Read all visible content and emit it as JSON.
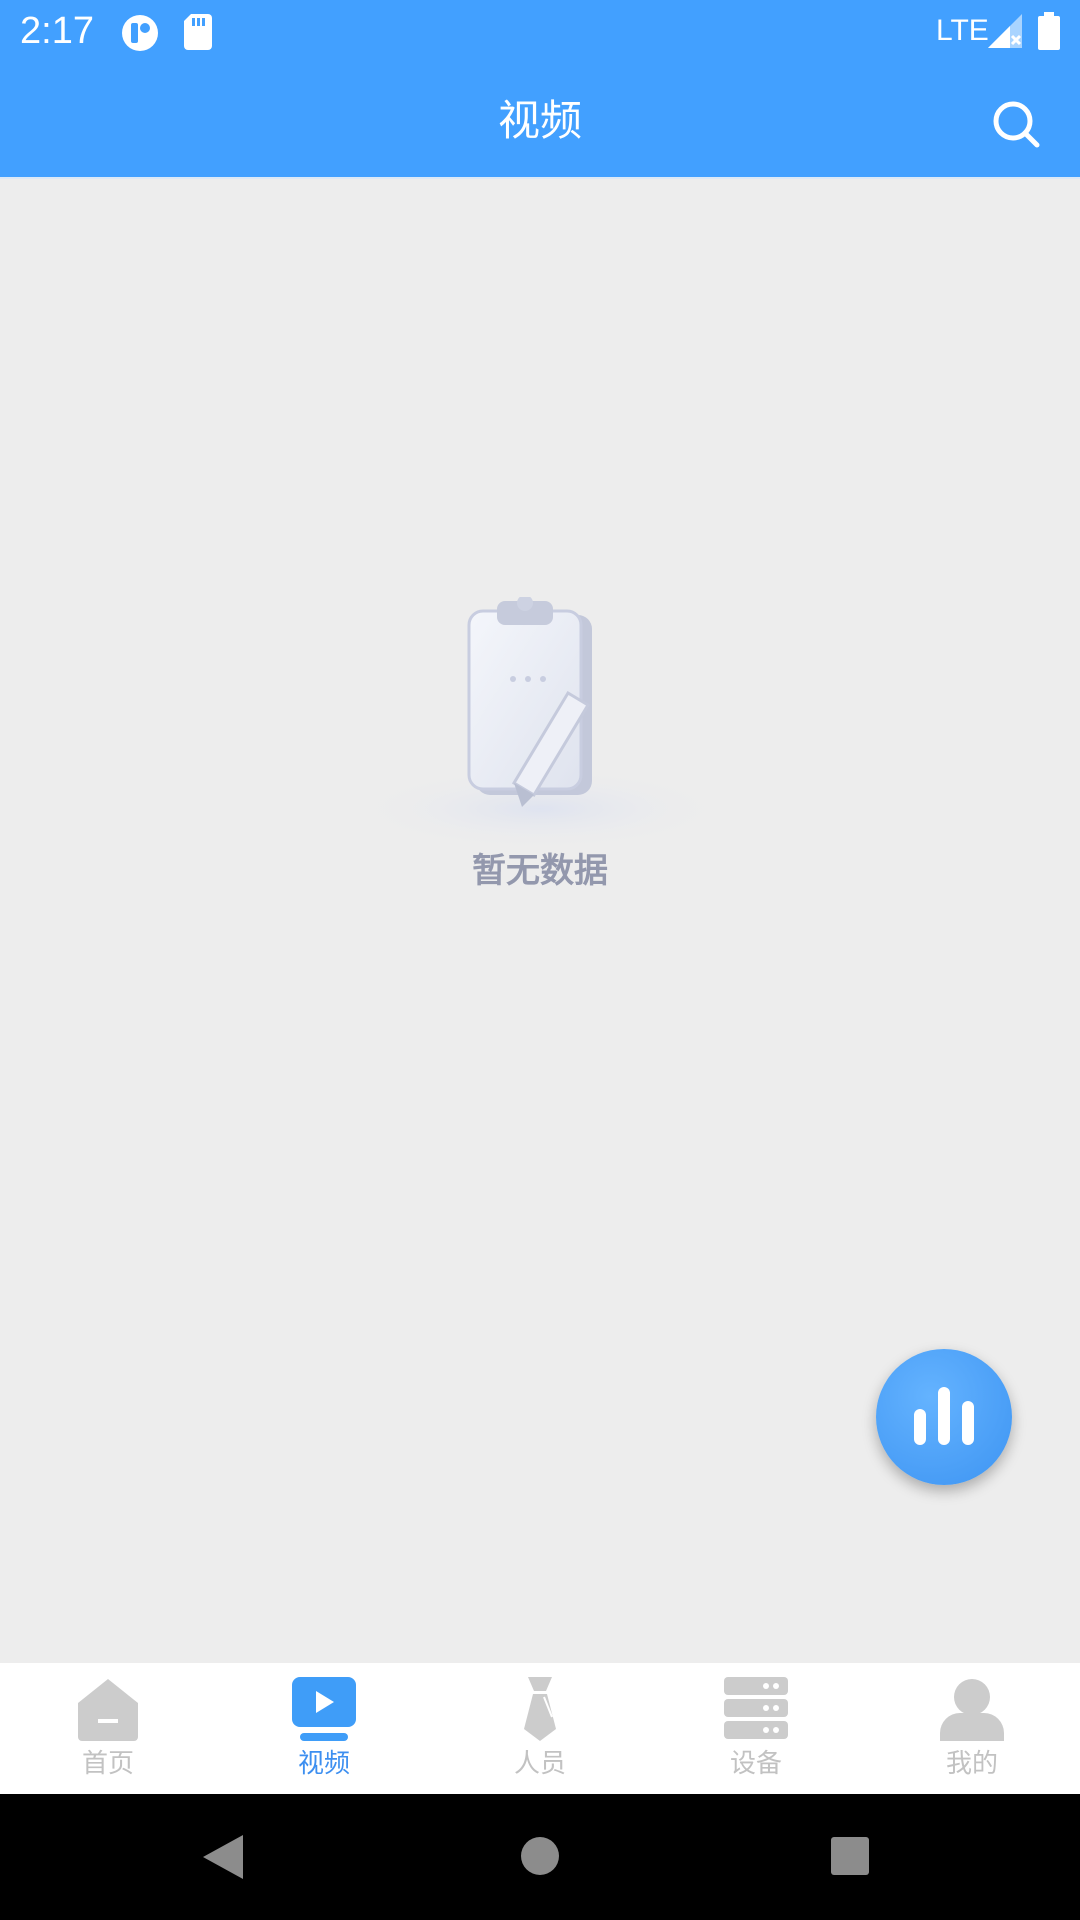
{
  "status_bar": {
    "time": "2:17",
    "network": "LTE"
  },
  "header": {
    "title": "视频"
  },
  "empty_state": {
    "message": "暂无数据"
  },
  "bottom_nav": {
    "items": [
      {
        "label": "首页",
        "icon": "home-icon",
        "active": false
      },
      {
        "label": "视频",
        "icon": "video-icon",
        "active": true
      },
      {
        "label": "人员",
        "icon": "tie-icon",
        "active": false
      },
      {
        "label": "设备",
        "icon": "server-icon",
        "active": false
      },
      {
        "label": "我的",
        "icon": "user-icon",
        "active": false
      }
    ]
  },
  "colors": {
    "primary": "#42a0ff",
    "background": "#ededed",
    "nav_active": "#3d8ff0",
    "nav_inactive": "#c2c2c2",
    "empty_text": "#9398ad"
  }
}
